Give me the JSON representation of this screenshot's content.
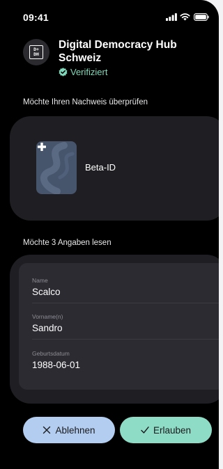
{
  "status_bar": {
    "time": "09:41",
    "icons": [
      "signal-icon",
      "wifi-icon",
      "battery-icon"
    ]
  },
  "issuer": {
    "logo_text": "D+ DH",
    "name": "Digital Democracy Hub Schweiz",
    "verified_label": "Verifiziert"
  },
  "credential_section": {
    "title": "Möchte Ihren Nachweis überprüfen",
    "credential_name": "Beta-ID"
  },
  "claims_section": {
    "title": "Möchte 3 Angaben lesen",
    "claims": [
      {
        "label": "Name",
        "value": "Scalco"
      },
      {
        "label": "Vorname(n)",
        "value": "Sandro"
      },
      {
        "label": "Geburtsdatum",
        "value": "1988-06-01"
      }
    ]
  },
  "actions": {
    "reject_label": "Ablehnen",
    "allow_label": "Erlauben"
  },
  "colors": {
    "background": "#000000",
    "panel": "#1f1e22",
    "card": "#2c2b31",
    "verified": "#7fd8bb",
    "reject_button": "#b3cdf0",
    "allow_button": "#8fdcc6"
  }
}
